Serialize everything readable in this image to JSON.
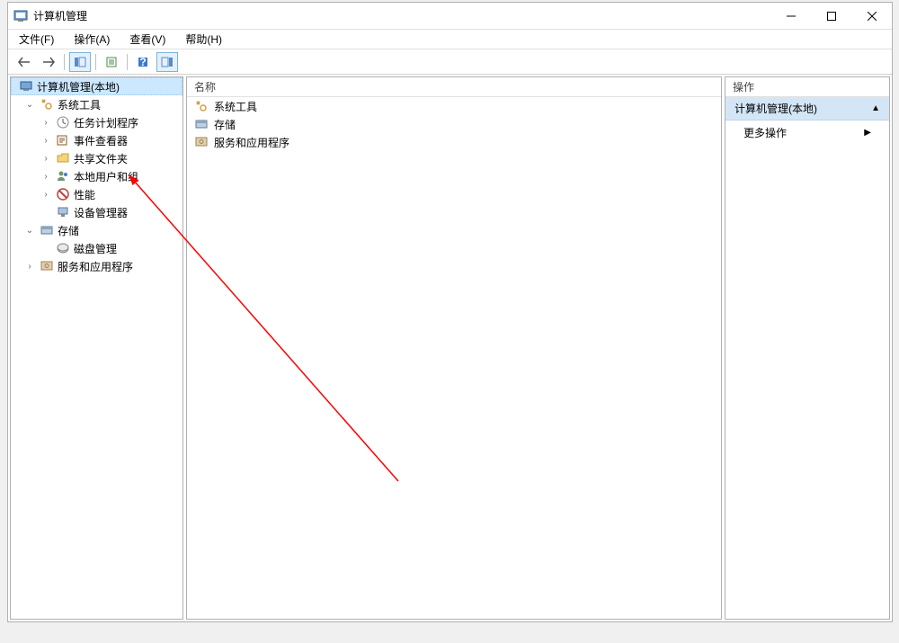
{
  "window": {
    "title": "计算机管理"
  },
  "menubar": {
    "file": "文件(F)",
    "action": "操作(A)",
    "view": "查看(V)",
    "help": "帮助(H)"
  },
  "tree": {
    "root": "计算机管理(本地)",
    "system_tools": "系统工具",
    "task_scheduler": "任务计划程序",
    "event_viewer": "事件查看器",
    "shared_folders": "共享文件夹",
    "local_users_groups": "本地用户和组",
    "performance": "性能",
    "device_manager": "设备管理器",
    "storage": "存储",
    "disk_management": "磁盘管理",
    "services_apps": "服务和应用程序"
  },
  "list": {
    "header_name": "名称",
    "item_system_tools": "系统工具",
    "item_storage": "存储",
    "item_services": "服务和应用程序"
  },
  "actions": {
    "header": "操作",
    "group_title": "计算机管理(本地)",
    "more_actions": "更多操作"
  }
}
